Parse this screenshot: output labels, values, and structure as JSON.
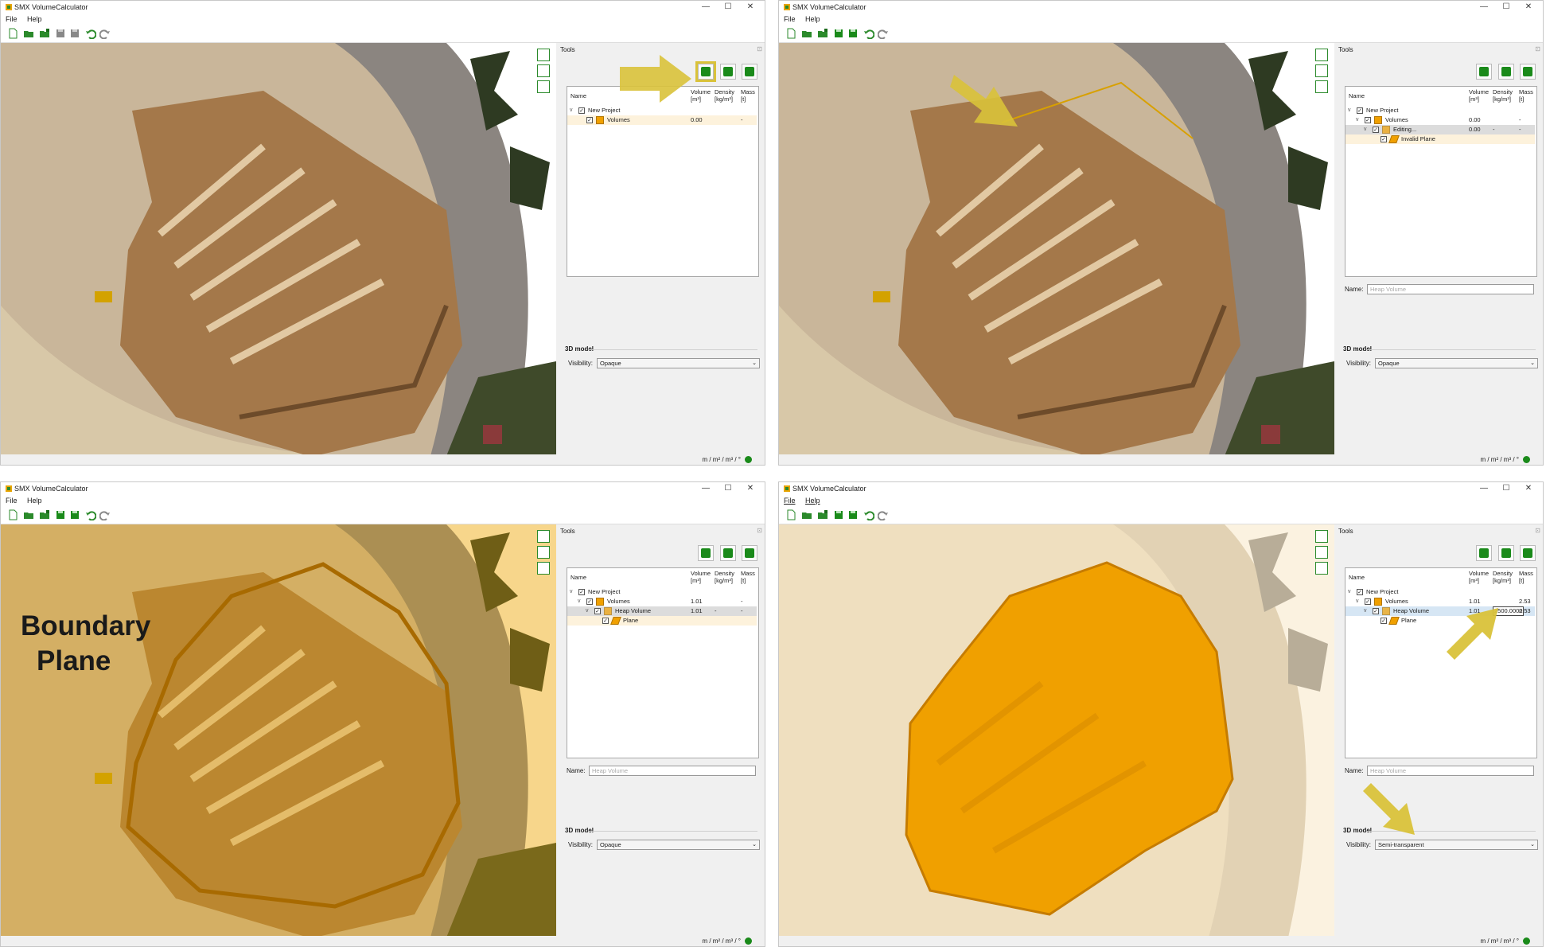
{
  "window": {
    "title": "SMX VolumeCalculator",
    "menu": [
      "File",
      "Help"
    ],
    "min": "—",
    "max": "☐",
    "close": "✕"
  },
  "panel": {
    "title": "Tools",
    "headers": {
      "name": "Name",
      "volume": "Volume",
      "volume_unit": "[m³]",
      "density": "Density",
      "density_unit": "[kg/m³]",
      "mass": "Mass",
      "mass_unit": "[t]"
    },
    "name_label": "Name:",
    "name_placeholder": "Heap Volume",
    "model_label": "3D model",
    "visibility_label": "Visibility:",
    "units": "m / m² / m³ / °"
  },
  "q1": {
    "rows": [
      {
        "label": "New Project",
        "v": "",
        "d": "",
        "m": ""
      },
      {
        "label": "Volumes",
        "v": "0.00",
        "d": "",
        "m": "-"
      }
    ],
    "visibility": "Opaque"
  },
  "q2": {
    "rows": [
      {
        "label": "New Project",
        "v": "",
        "d": "",
        "m": ""
      },
      {
        "label": "Volumes",
        "v": "0.00",
        "d": "",
        "m": "-"
      },
      {
        "label": "Editing...",
        "v": "0.00",
        "d": "-",
        "m": "-"
      },
      {
        "label": "Invalid Plane",
        "v": "",
        "d": "",
        "m": ""
      }
    ],
    "visibility": "Opaque"
  },
  "q3": {
    "rows": [
      {
        "label": "New Project",
        "v": "",
        "d": "",
        "m": ""
      },
      {
        "label": "Volumes",
        "v": "1.01",
        "d": "",
        "m": "-"
      },
      {
        "label": "Heap Volume",
        "v": "1.01",
        "d": "-",
        "m": "-"
      },
      {
        "label": "Plane",
        "v": "",
        "d": "",
        "m": ""
      }
    ],
    "visibility": "Opaque",
    "overlay_line1": "Boundary",
    "overlay_line2": "Plane"
  },
  "q4": {
    "rows": [
      {
        "label": "New Project",
        "v": "",
        "d": "",
        "m": ""
      },
      {
        "label": "Volumes",
        "v": "1.01",
        "d": "",
        "m": "2.53"
      },
      {
        "label": "Heap Volume",
        "v": "1.01",
        "d": "2500.0000",
        "m": "2.53"
      },
      {
        "label": "Plane",
        "v": "",
        "d": "",
        "m": ""
      }
    ],
    "visibility": "Semi-transparent"
  },
  "colors": {
    "accent_arrow": "#d9c23a",
    "volume_orange": "#f0a000",
    "ok_green": "#1a8a1a"
  }
}
